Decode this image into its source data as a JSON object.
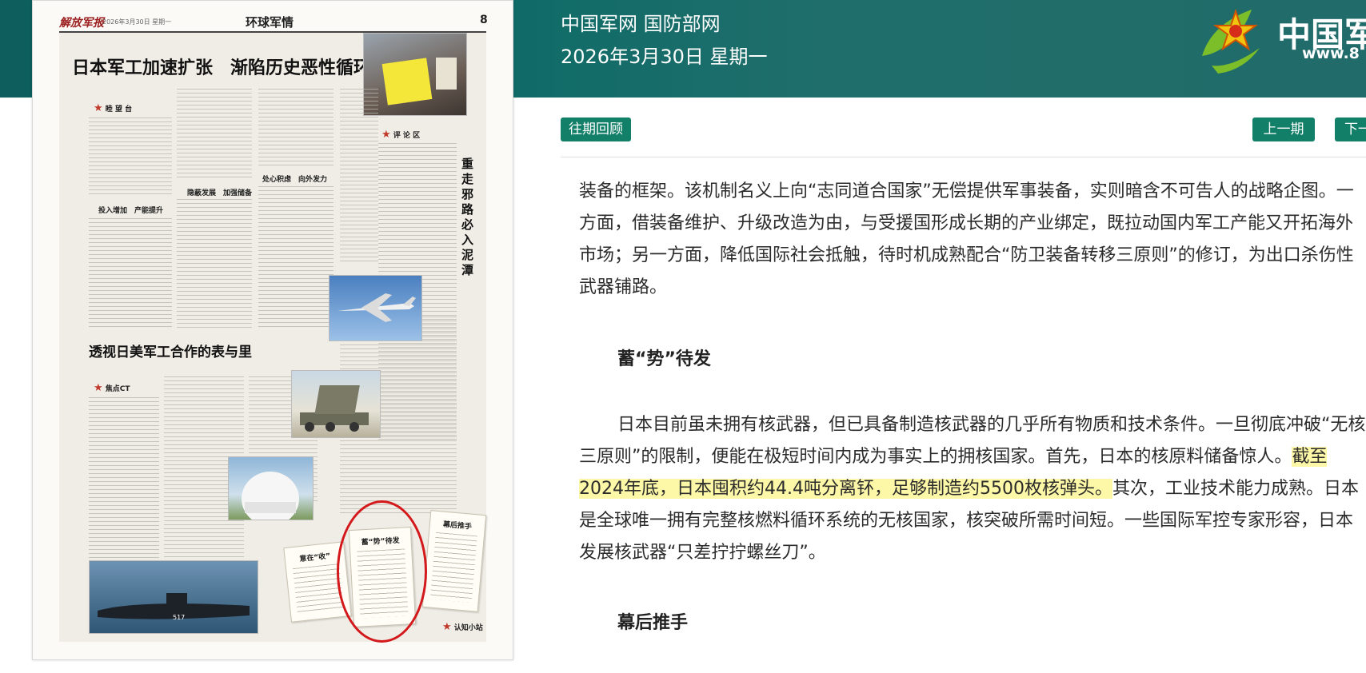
{
  "site": {
    "name_line": "中国军网 国防部网",
    "date_line": "2026年3月30日 星期一",
    "logo_text": "中国军",
    "logo_url": "www.8"
  },
  "newspaper": {
    "masthead": "解放军报",
    "date": "2026年3月30日 星期一",
    "section": "环球军情",
    "page_no": "8",
    "headline": "日本军工加速扩张　渐陷历史恶性循环",
    "subheadline": "透视日美军工合作的表与里",
    "vertical_title": "重走邪路　必入泥潭",
    "col_heads": [
      "睦 望 台",
      "投入增加　产能提升",
      "隐蔽发展　加强储备",
      "处心积虑　向外发力",
      "评 论 区",
      "焦点CT"
    ],
    "notes": [
      "蓄“势”待发",
      "意在“收”",
      "幕后推手",
      "认知小站"
    ]
  },
  "controls": {
    "past_issues": "往期回顾",
    "prev": "上一期",
    "next": "下一"
  },
  "article": {
    "para1": "装备的框架。该机制名义上向“志同道合国家”无偿提供军事装备，实则暗含不可告人的战略企图。一方面，借装备维护、升级改造为由，与受援国形成长期的产业绑定，既拉动国内军工产能又开拓海外市场；另一方面，降低国际社会抵触，待时机成熟配合“防卫装备转移三原则”的修订，为出口杀伤性武器铺路。",
    "section1": "蓄“势”待发",
    "para2_before": "日本目前虽未拥有核武器，但已具备制造核武器的几乎所有物质和技术条件。一旦彻底冲破“无核三原则”的限制，便能在极短时间内成为事实上的拥核国家。首先，日本的核原料储备惊人。",
    "para2_highlight": "截至2024年底，日本囤积约44.4吨分离钚，足够制造约5500枚核弹头。",
    "para2_after": "其次，工业技术能力成熟。日本是全球唯一拥有完整核燃料循环系统的无核国家，核突破所需时间短。一些国际军控专家形容，日本发展核武器“只差拧拧螺丝刀”。",
    "section2": "幕后推手"
  }
}
